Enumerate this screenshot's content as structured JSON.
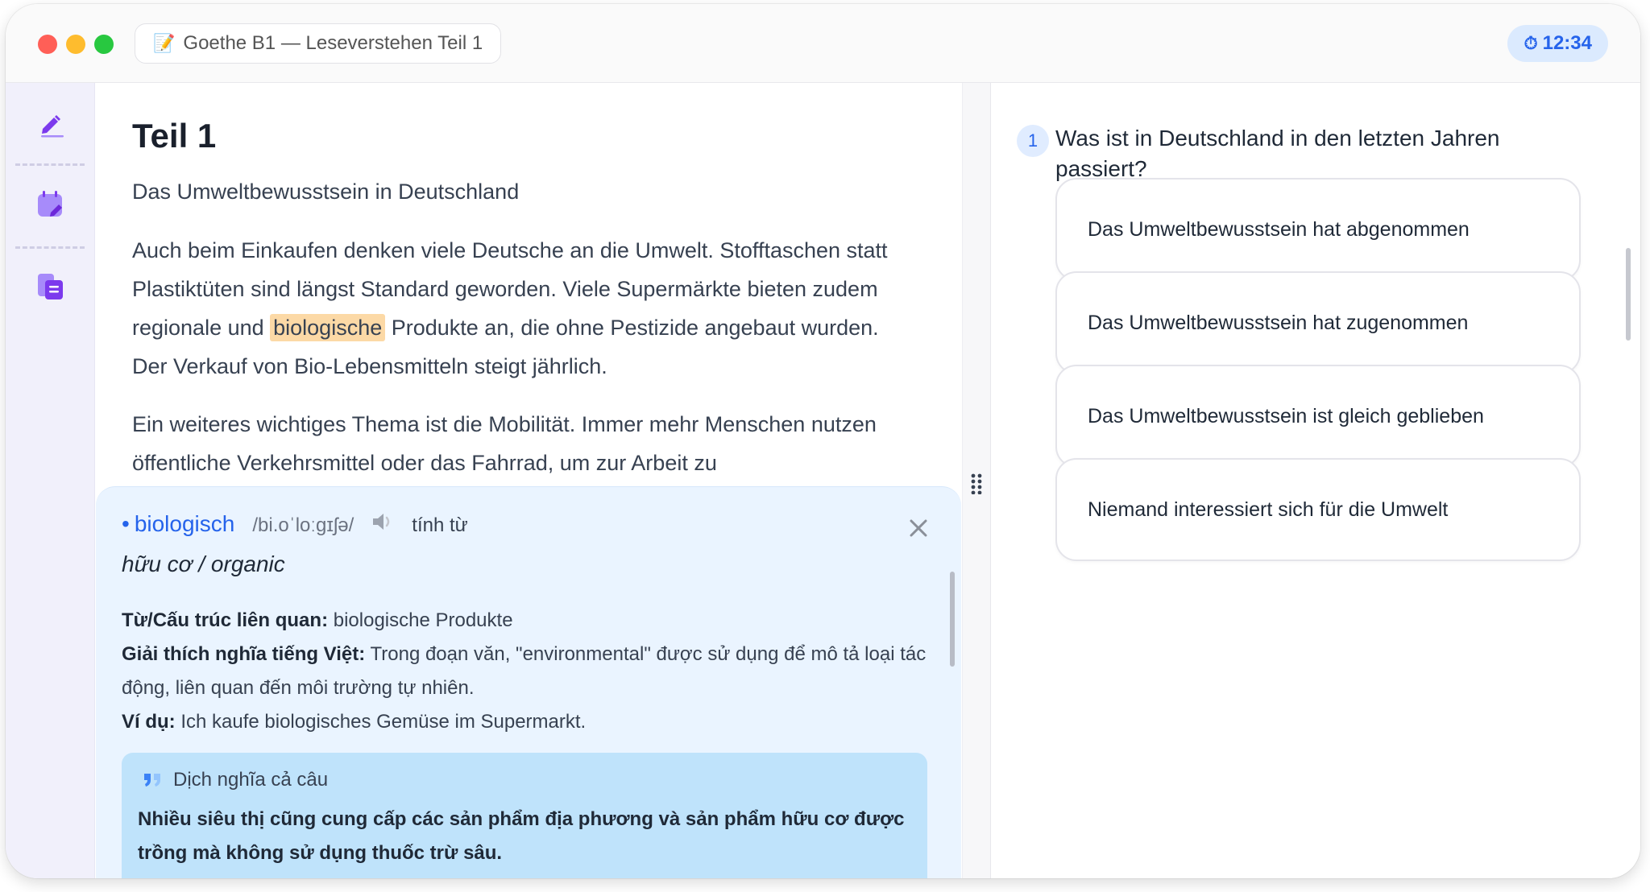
{
  "window": {
    "tab_icon": "memo-icon",
    "tab_title": "Goethe B1 — Leseverstehen Teil 1",
    "timer": "12:34",
    "timer_icon": "stopwatch-icon"
  },
  "sidebar": {
    "items": [
      {
        "name": "edit-icon"
      },
      {
        "name": "calendar-edit-icon"
      },
      {
        "name": "documents-icon"
      }
    ]
  },
  "reading": {
    "title": "Teil 1",
    "subtitle": "Das Umweltbewusstsein in Deutschland",
    "p1_before": "Auch beim Einkaufen denken viele Deutsche an die Umwelt. Stofftaschen statt Plastiktüten sind längst Standard geworden. Viele Supermärkte bieten zudem regionale und ",
    "p1_highlight": "biologische",
    "p1_after": " Produkte an, die ohne Pestizide angebaut wurden. Der Verkauf von Bio-Lebensmitteln steigt jährlich.",
    "p2": "Ein weiteres wichtiges Thema ist die Mobilität. Immer mehr Menschen nutzen öffentliche Verkehrsmittel oder das Fahrrad, um zur Arbeit zu"
  },
  "vocab": {
    "word": "biologisch",
    "ipa": "/bi.oˈloːɡɪʃə/",
    "pos": "tính từ",
    "meaning": "hữu cơ / organic",
    "related_label": "Từ/Cấu trúc liên quan:",
    "related_value": " biologische Produkte",
    "explain_label": "Giải thích nghĩa tiếng Việt:",
    "explain_value": " Trong đoạn văn, \"environmental\" được sử dụng để mô tả loại tác động, liên quan đến môi trường tự nhiên.",
    "example_label": "Ví dụ:",
    "example_value": " Ich kaufe biologisches Gemüse im Supermarkt.",
    "translate_title": "Dịch nghĩa cả câu",
    "translate_text": "Nhiều siêu thị cũng cung cấp các sản phẩm địa phương và sản phẩm hữu cơ được trồng mà không sử dụng thuốc trừ sâu."
  },
  "question": {
    "number": "1",
    "text": "Was ist in Deutschland in den letzten Jahren passiert?",
    "options": [
      "Das Umweltbewusstsein hat abgenommen",
      "Das Umweltbewusstsein hat zugenommen",
      "Das Umweltbewusstsein ist gleich geblieben",
      "Niemand interessiert sich für die Umwelt"
    ]
  },
  "colors": {
    "accent": "#2563eb",
    "sidebar_icon": "#7c3aed",
    "highlight": "#fcd9a6",
    "vocab_bg": "#eaf4ff",
    "translate_bg": "#bfe3fb"
  }
}
